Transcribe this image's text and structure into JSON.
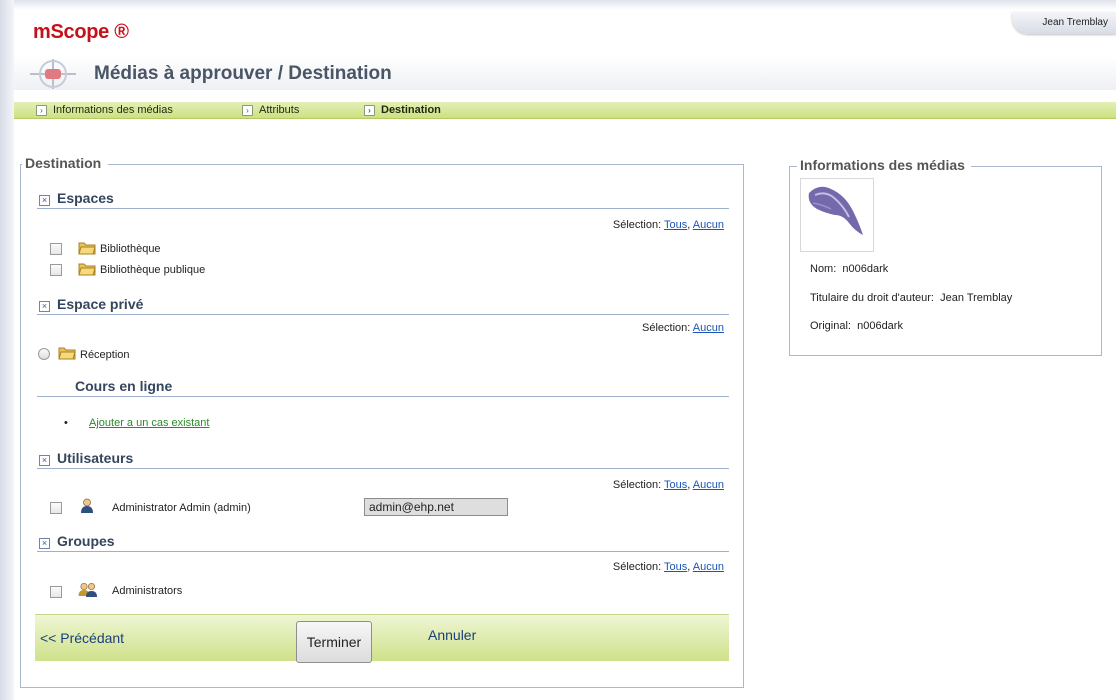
{
  "app": {
    "brand": "mScope ®",
    "user": "Jean Tremblay"
  },
  "header": {
    "title": "Médias à approuver / Destination"
  },
  "tabs": [
    {
      "label": "Informations des médias",
      "active": false
    },
    {
      "label": "Attributs",
      "active": false
    },
    {
      "label": "Destination",
      "active": true
    }
  ],
  "destination": {
    "legend": "Destination",
    "espaces": {
      "title": "Espaces",
      "selection_label": "Sélection:",
      "all": "Tous",
      "none": "Aucun",
      "items": [
        "Bibliothèque",
        "Bibliothèque publique"
      ]
    },
    "prive": {
      "title": "Espace privé",
      "selection_label": "Sélection:",
      "none": "Aucun",
      "items": [
        "Réception"
      ]
    },
    "cours": {
      "title": "Cours en ligne",
      "bullet": "•",
      "link": "Ajouter a un cas existant"
    },
    "utilisateurs": {
      "title": "Utilisateurs",
      "selection_label": "Sélection:",
      "all": "Tous",
      "none": "Aucun",
      "user_name": "Administrator Admin (admin)",
      "user_email": "admin@ehp.net"
    },
    "groupes": {
      "title": "Groupes",
      "selection_label": "Sélection:",
      "all": "Tous",
      "none": "Aucun",
      "items": [
        "Administrators"
      ]
    }
  },
  "footer": {
    "previous": "<< Précédant",
    "finish": "Terminer",
    "cancel": "Annuler"
  },
  "info": {
    "legend": "Informations des médias",
    "name_label": "Nom:",
    "name_value": "n006dark",
    "copyright_label": "Titulaire du droit d'auteur:",
    "copyright_value": "Jean Tremblay",
    "original_label": "Original:",
    "original_value": "n006dark"
  },
  "colors": {
    "brand": "#c6101a",
    "tab_bar": "#cde17f",
    "link": "#1a55b5",
    "link_green": "#2a8a2a",
    "section_title": "#34455e"
  },
  "icons": [
    "folder-icon",
    "user-icon",
    "group-icon",
    "arrow-right-icon",
    "collapse-x-icon",
    "mscope-logo-icon",
    "media-thumbnail"
  ]
}
